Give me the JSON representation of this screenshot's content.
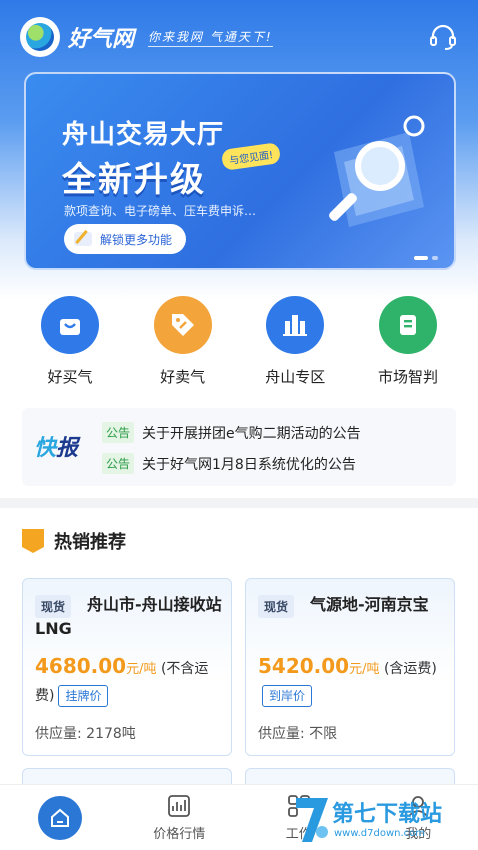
{
  "header": {
    "brand": "好气网",
    "slogan": "你来我网 气通天下!"
  },
  "banner": {
    "title": "舟山交易大厅",
    "headline": "全新升级",
    "tag": "与您见面!",
    "subtitle": "款项查询、电子磅单、压车费申诉…",
    "button_label": "解锁更多功能"
  },
  "quick_links": [
    {
      "label": "好买气",
      "color": "#2f7ae8",
      "icon": "shopping-bag-icon"
    },
    {
      "label": "好卖气",
      "color": "#f3a43a",
      "icon": "price-tag-icon"
    },
    {
      "label": "舟山专区",
      "color": "#2f7ae8",
      "icon": "buildings-icon"
    },
    {
      "label": "市场智判",
      "color": "#2fb36a",
      "icon": "document-icon"
    }
  ],
  "notice": {
    "logo_a": "快",
    "logo_b": "报",
    "items": [
      {
        "badge": "公告",
        "text": "关于开展拼团e气购二期活动的公告"
      },
      {
        "badge": "公告",
        "text": "关于好气网1月8日系统优化的公告"
      }
    ]
  },
  "section": {
    "title": "热销推荐"
  },
  "cards": [
    {
      "tag": "现货",
      "name": "舟山市-舟山接收站LNG",
      "price": "4680.00",
      "unit": "元/吨",
      "note": "(不含运费)",
      "price_type": "挂牌价",
      "supply_label": "供应量:",
      "supply": "2178吨"
    },
    {
      "tag": "现货",
      "name": "气源地-河南京宝",
      "price": "5420.00",
      "unit": "元/吨",
      "note": "(含运费)",
      "price_type": "到岸价",
      "supply_label": "供应量:",
      "supply": "不限"
    }
  ],
  "tabbar": [
    {
      "label": "",
      "icon": "home-icon"
    },
    {
      "label": "价格行情",
      "icon": "chart-icon"
    },
    {
      "label": "工作",
      "icon": "briefcase-icon"
    },
    {
      "label": "我的",
      "icon": "user-icon"
    }
  ],
  "watermark": {
    "text": "第七下载站",
    "url": "www.d7down.com"
  }
}
